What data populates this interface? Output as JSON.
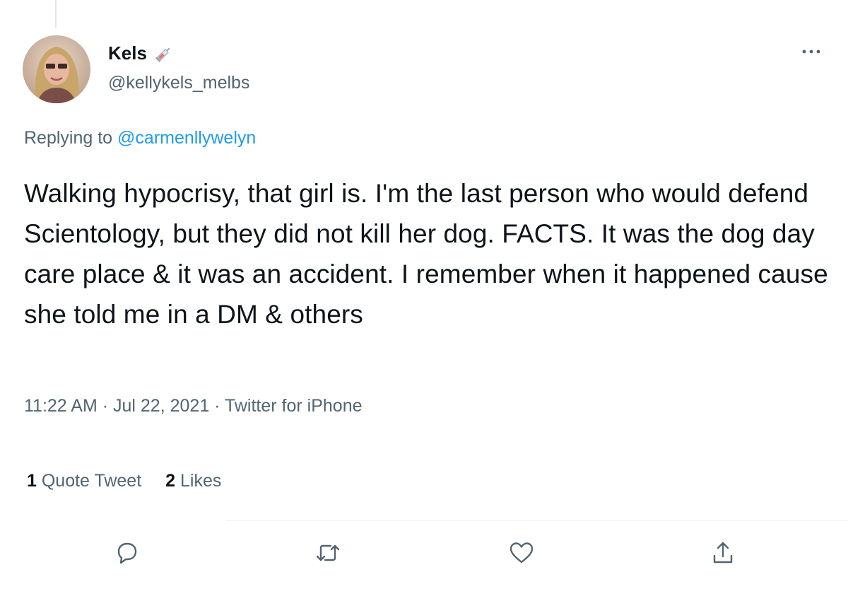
{
  "author": {
    "display_name": "Kels",
    "handle": "@kellykels_melbs",
    "avatar_icon": "profile-photo-avatar",
    "badge_icon": "syringe-emoji-icon"
  },
  "reply": {
    "prefix": "Replying to ",
    "mention": "@carmenllywelyn"
  },
  "tweet": {
    "text": "Walking hypocrisy, that girl is. I'm the last person who would defend Scientology, but they did not kill her dog. FACTS. It was the dog day care place & it was an accident. I remember when it happened cause she told me in a DM & others"
  },
  "meta": {
    "time": "11:22 AM",
    "separator": " · ",
    "date": "Jul 22, 2021",
    "source": "Twitter for iPhone"
  },
  "stats": {
    "quote_count": "1",
    "quote_label": "Quote Tweet",
    "like_count": "2",
    "like_label": "Likes"
  },
  "actions": {
    "reply_icon": "reply-icon",
    "retweet_icon": "retweet-icon",
    "like_icon": "heart-icon",
    "share_icon": "share-icon",
    "more_icon": "more-options-icon"
  },
  "colors": {
    "text": "#0f1419",
    "secondary": "#536471",
    "link": "#1d9bf0"
  }
}
